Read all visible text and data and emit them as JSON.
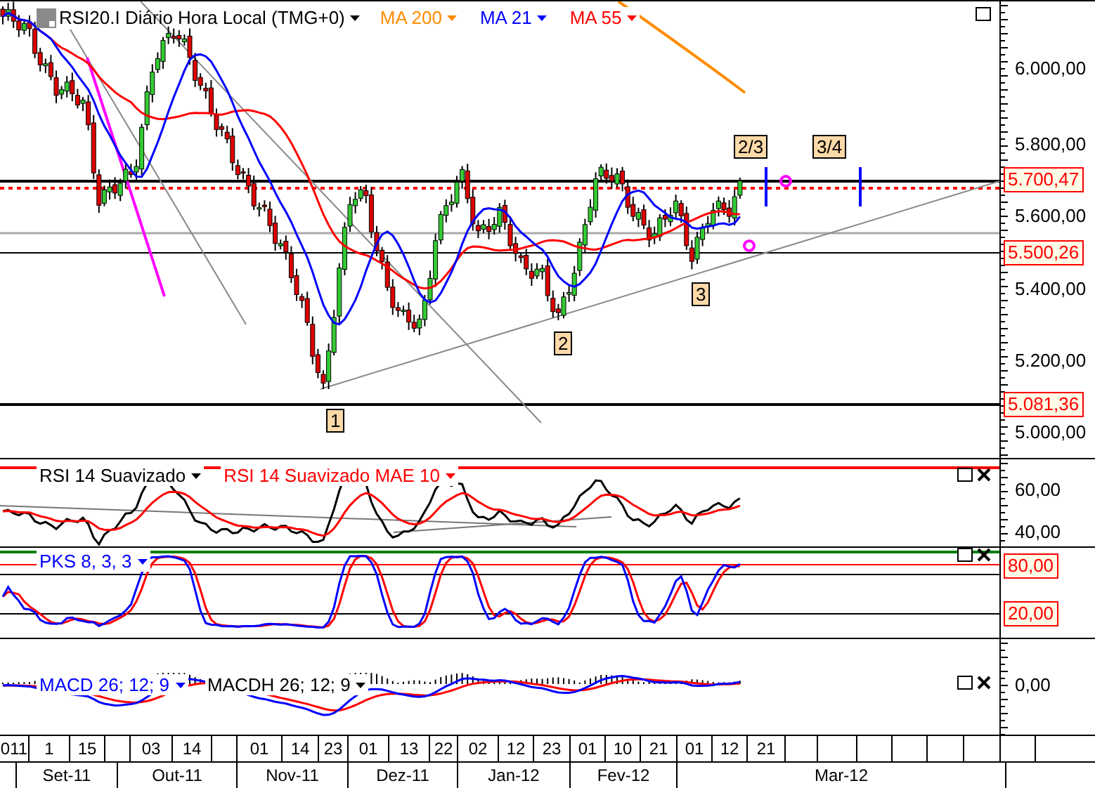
{
  "main_chart": {
    "title": "RSI20.I Diário Hora Local (TMG+0)",
    "indicators": [
      {
        "label": "MA 200",
        "color": "#ff8c00"
      },
      {
        "label": "MA 21",
        "color": "#0000ff"
      },
      {
        "label": "MA 55",
        "color": "#ff0000"
      }
    ],
    "price_axis": [
      "6.000,00",
      "5.800,00",
      "5.600,00",
      "5.400,00",
      "5.200,00",
      "5.000,00"
    ],
    "price_tags": [
      "5.700,47",
      "5.500,26",
      "5.081,36"
    ],
    "wave_labels": [
      "1",
      "2",
      "3",
      "2/3",
      "3/4"
    ]
  },
  "rsi_panel": {
    "indicators": [
      {
        "label": "RSI 14 Suavizado",
        "color": "#000000"
      },
      {
        "label": "RSI 14 Suavizado MAE 10",
        "color": "#ff0000"
      }
    ],
    "axis": [
      "60,00",
      "40,00"
    ]
  },
  "pks_panel": {
    "indicators": [
      {
        "label": "PKS 8, 3, 3",
        "color": "#0000ff"
      }
    ],
    "level_tags": [
      "80,00",
      "20,00"
    ]
  },
  "macd_panel": {
    "indicators": [
      {
        "label": "MACD 26; 12; 9",
        "color": "#0000ff"
      },
      {
        "label": "MACDH 26; 12; 9",
        "color": "#000000"
      }
    ],
    "axis": [
      "0,00"
    ]
  },
  "date_axis": {
    "days": [
      "011",
      "1",
      "15",
      "03",
      "14",
      "01",
      "14",
      "23",
      "01",
      "13",
      "22",
      "02",
      "12",
      "23",
      "01",
      "10",
      "21",
      "01",
      "12",
      "21"
    ],
    "months": [
      "Set-11",
      "Out-11",
      "Nov-11",
      "Dez-11",
      "Jan-12",
      "Fev-12",
      "Mar-12"
    ]
  }
}
